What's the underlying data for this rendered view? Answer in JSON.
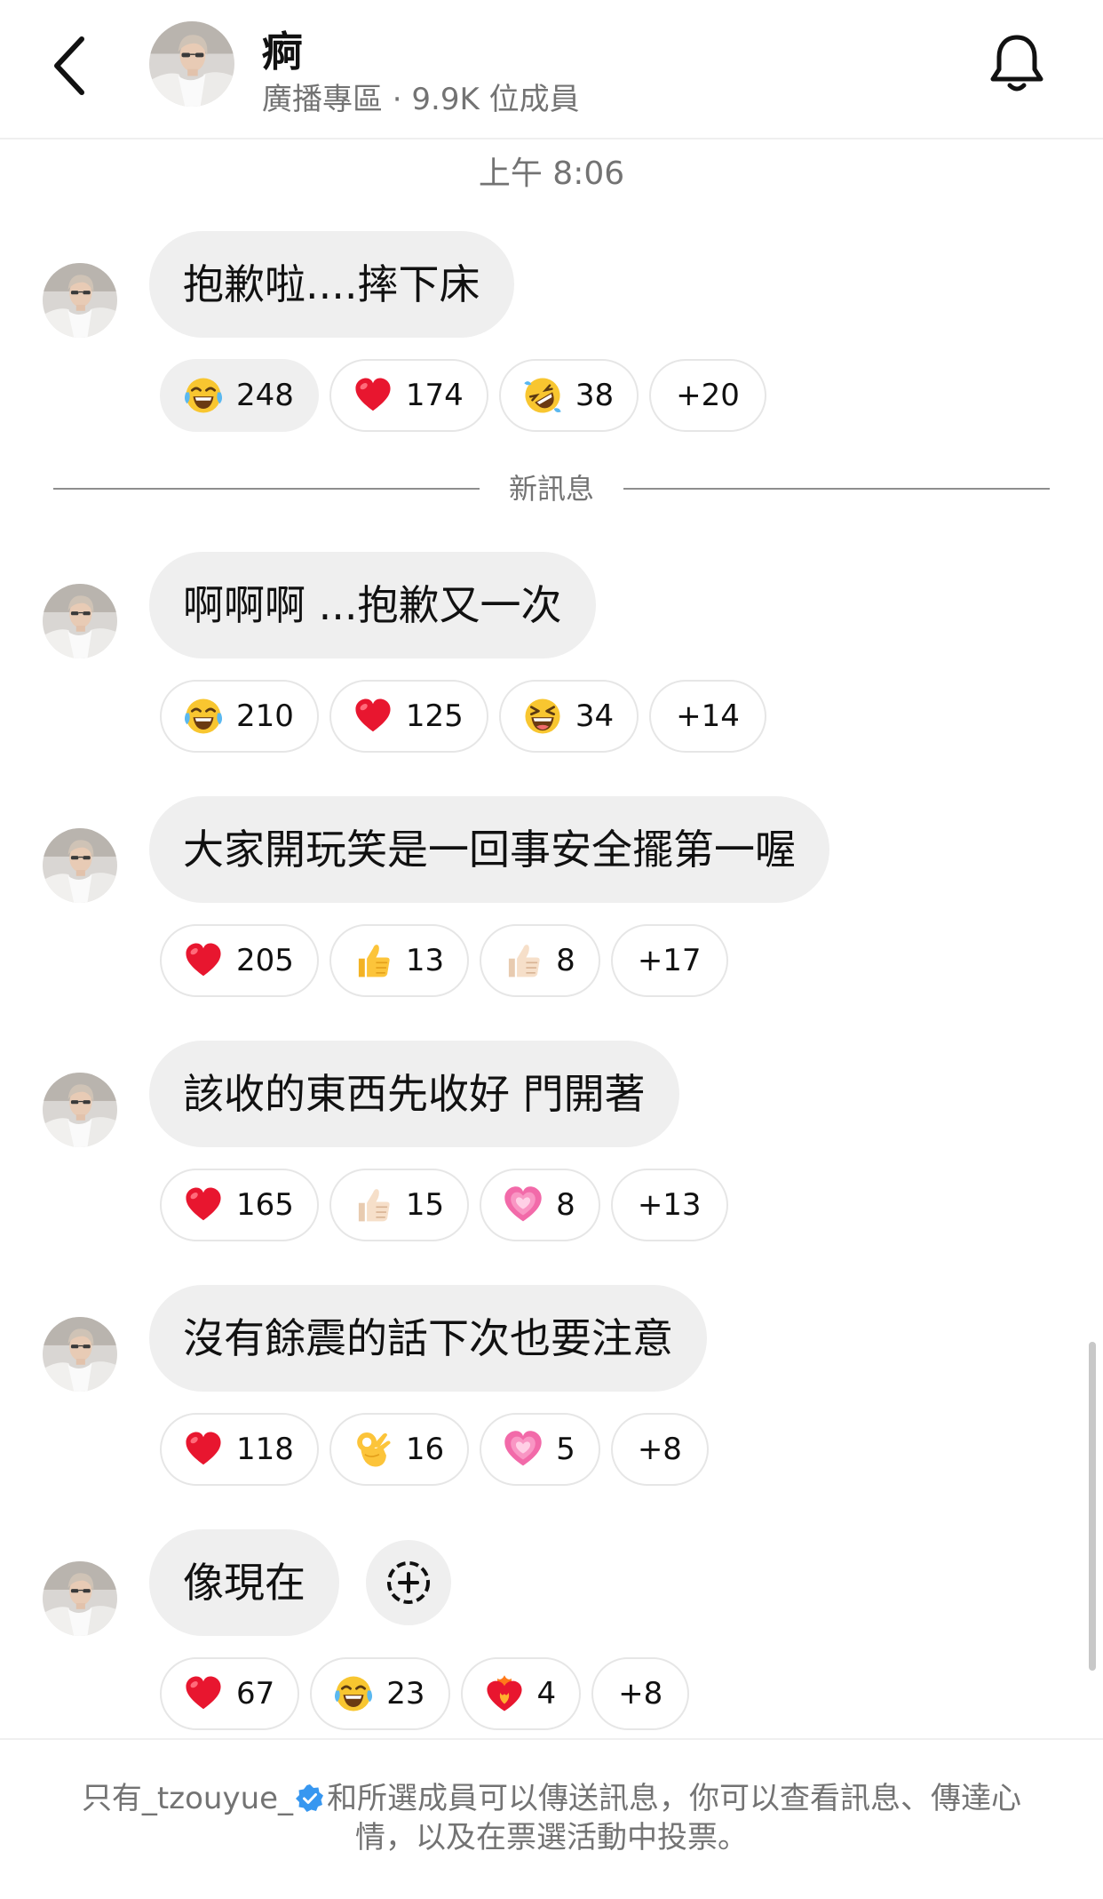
{
  "header": {
    "title": "痾",
    "subtitle": "廣播專區 · 9.9K 位成員"
  },
  "timestamp": "上午 8:06",
  "divider_label": "新訊息",
  "messages": [
    {
      "text": "抱歉啦....摔下床",
      "reactions": [
        {
          "emoji": "joy",
          "count": "248"
        },
        {
          "emoji": "heart",
          "count": "174"
        },
        {
          "emoji": "rofl",
          "count": "38"
        }
      ],
      "more": "+20"
    },
    {
      "text": "啊啊啊 ...抱歉又一次",
      "reactions": [
        {
          "emoji": "joy",
          "count": "210"
        },
        {
          "emoji": "heart",
          "count": "125"
        },
        {
          "emoji": "laughing",
          "count": "34"
        }
      ],
      "more": "+14"
    },
    {
      "text": "大家開玩笑是一回事安全擺第一喔",
      "reactions": [
        {
          "emoji": "heart",
          "count": "205"
        },
        {
          "emoji": "thumbs-up",
          "count": "13"
        },
        {
          "emoji": "thumbs-up-light",
          "count": "8"
        }
      ],
      "more": "+17"
    },
    {
      "text": "該收的東西先收好 門開著",
      "reactions": [
        {
          "emoji": "heart",
          "count": "165"
        },
        {
          "emoji": "thumbs-up-light",
          "count": "15"
        },
        {
          "emoji": "growing-heart",
          "count": "8"
        }
      ],
      "more": "+13"
    },
    {
      "text": "沒有餘震的話下次也要注意",
      "reactions": [
        {
          "emoji": "heart",
          "count": "118"
        },
        {
          "emoji": "ok-hand",
          "count": "16"
        },
        {
          "emoji": "growing-heart",
          "count": "5"
        }
      ],
      "more": "+8"
    },
    {
      "text": "像現在",
      "reactions": [
        {
          "emoji": "heart",
          "count": "67"
        },
        {
          "emoji": "joy",
          "count": "23"
        },
        {
          "emoji": "heart-on-fire",
          "count": "4"
        }
      ],
      "more": "+8"
    }
  ],
  "footer": {
    "prefix": "只有_tzouyue_",
    "suffix": "和所選成員可以傳送訊息，你可以查看訊息、傳達心情，以及在票選活動中投票。"
  }
}
